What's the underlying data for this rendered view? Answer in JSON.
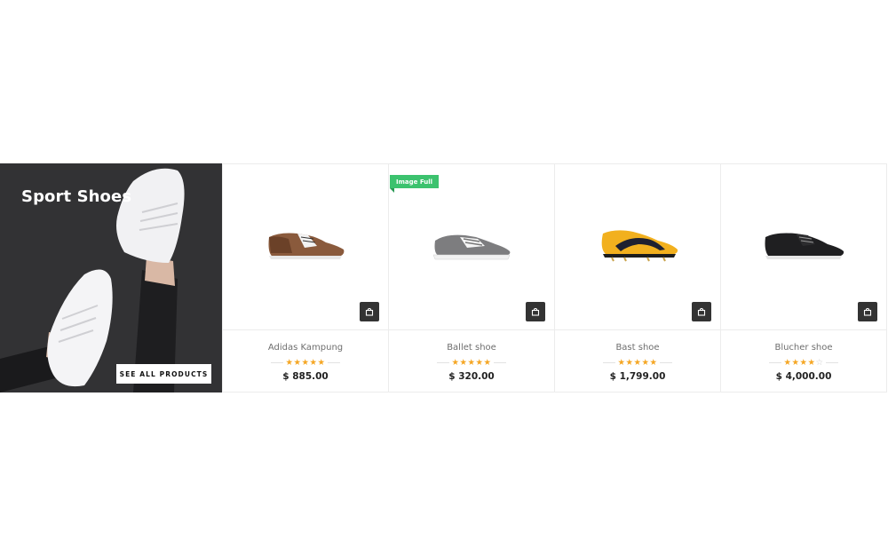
{
  "banner": {
    "title": "Sport Shoes",
    "button_label": "SEE ALL PRODUCTS"
  },
  "badge": {
    "label": "Image Full",
    "color": "#3cc26e"
  },
  "colors": {
    "star": "#f5a623",
    "cart_button": "#333333"
  },
  "products": [
    {
      "name": "Adidas Kampung",
      "price": "$ 885.00",
      "rating": 5,
      "cart_icon": "shopping-bag-icon"
    },
    {
      "name": "Ballet shoe",
      "price": "$ 320.00",
      "rating": 5,
      "cart_icon": "shopping-bag-icon"
    },
    {
      "name": "Bast shoe",
      "price": "$ 1,799.00",
      "rating": 5,
      "cart_icon": "shopping-bag-icon"
    },
    {
      "name": "Blucher shoe",
      "price": "$ 4,000.00",
      "rating": 4,
      "cart_icon": "shopping-bag-icon"
    }
  ]
}
